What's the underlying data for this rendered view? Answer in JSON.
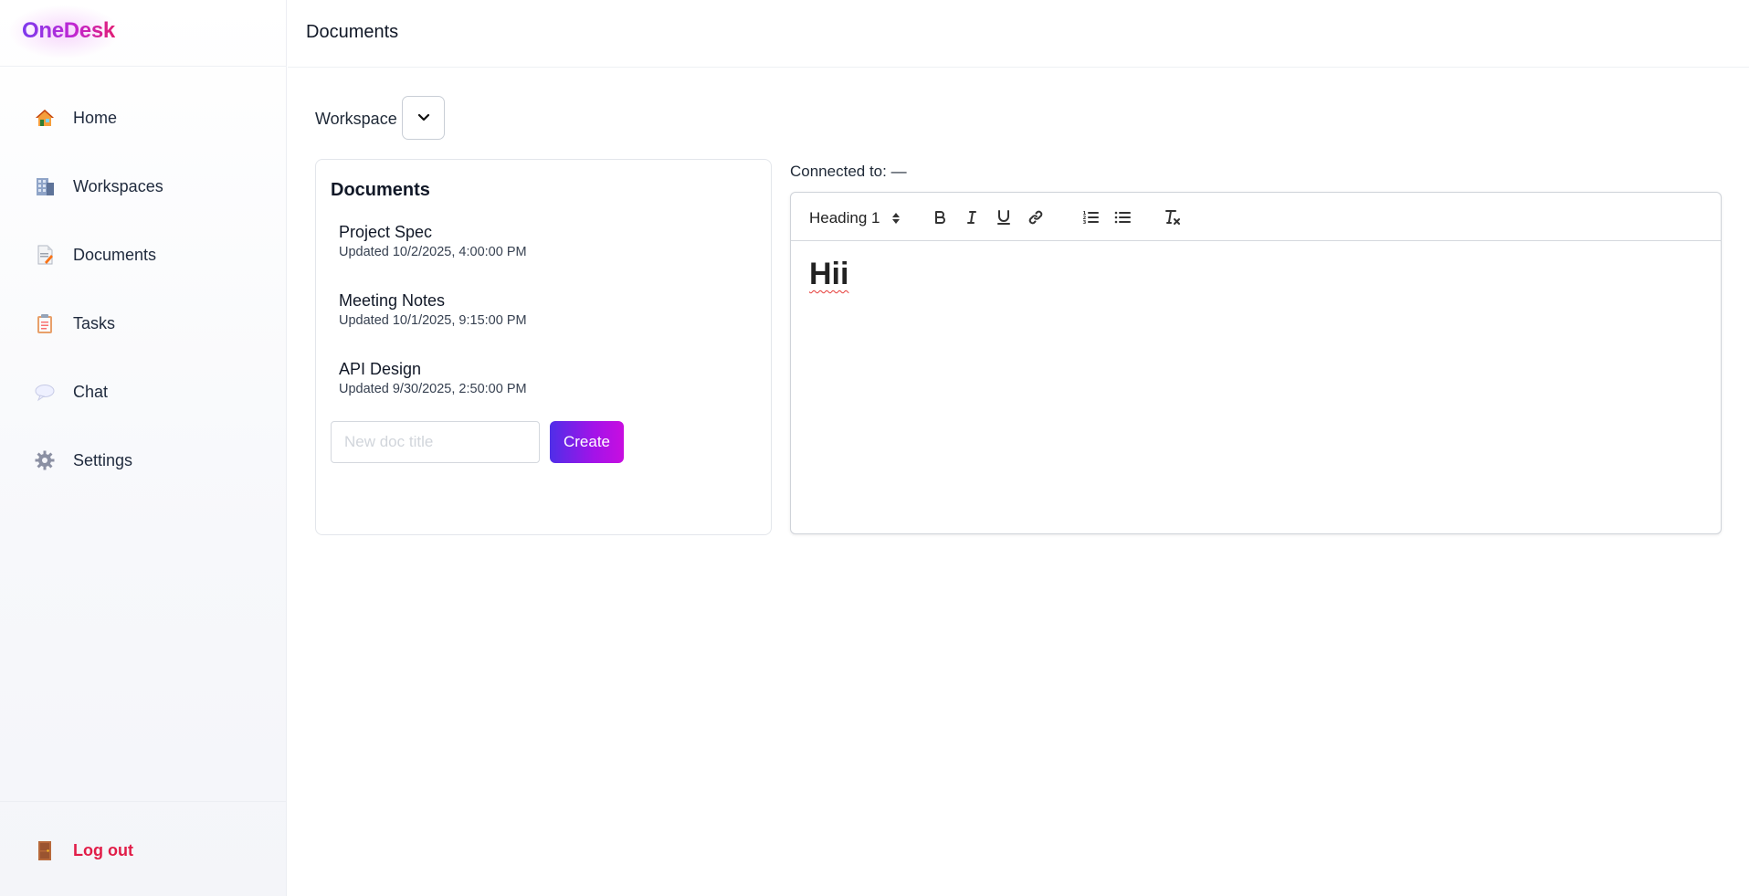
{
  "brand": {
    "name": "OneDesk"
  },
  "sidebar": {
    "items": [
      {
        "label": "Home",
        "icon": "house-icon"
      },
      {
        "label": "Workspaces",
        "icon": "office-building-icon"
      },
      {
        "label": "Documents",
        "icon": "document-icon"
      },
      {
        "label": "Tasks",
        "icon": "clipboard-icon"
      },
      {
        "label": "Chat",
        "icon": "speech-bubble-icon"
      },
      {
        "label": "Settings",
        "icon": "gear-icon"
      }
    ],
    "logout": {
      "label": "Log out",
      "icon": "door-icon"
    }
  },
  "header": {
    "title": "Documents"
  },
  "workspace": {
    "label": "Workspace",
    "selected": ""
  },
  "documents_panel": {
    "title": "Documents",
    "items": [
      {
        "name": "Project Spec",
        "updated": "Updated 10/2/2025, 4:00:00 PM"
      },
      {
        "name": "Meeting Notes",
        "updated": "Updated 10/1/2025, 9:15:00 PM"
      },
      {
        "name": "API Design",
        "updated": "Updated 9/30/2025, 2:50:00 PM"
      }
    ],
    "new_doc": {
      "placeholder": "New doc title",
      "value": ""
    },
    "create_label": "Create"
  },
  "editor": {
    "connected_text": "Connected to: —",
    "heading_format": "Heading 1",
    "toolbar_buttons": [
      "bold-icon",
      "italic-icon",
      "underline-icon",
      "link-icon",
      "ordered-list-icon",
      "bullet-list-icon",
      "clear-format-icon"
    ],
    "content": "Hii"
  },
  "colors": {
    "brand_gradient_start": "#7c3aed",
    "brand_gradient_end": "#e11d74",
    "create_button_start": "#4f2ee8",
    "create_button_end": "#c80ee0",
    "logout": "#e11d48"
  }
}
